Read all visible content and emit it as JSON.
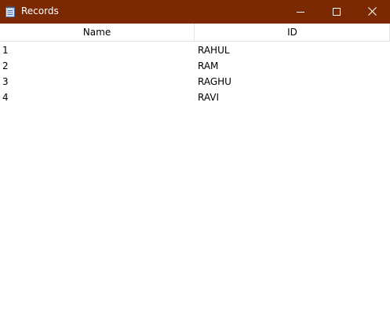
{
  "window": {
    "title": "Records",
    "titlebar_color": "#7a2903"
  },
  "table": {
    "columns": [
      "Name",
      "ID"
    ],
    "rows": [
      {
        "name": "1",
        "id": "RAHUL"
      },
      {
        "name": "2",
        "id": "RAM"
      },
      {
        "name": "3",
        "id": "RAGHU"
      },
      {
        "name": "4",
        "id": "RAVI"
      }
    ]
  },
  "icons": {
    "app": "notepad-icon",
    "minimize": "minimize-icon",
    "maximize": "maximize-icon",
    "close": "close-icon"
  }
}
